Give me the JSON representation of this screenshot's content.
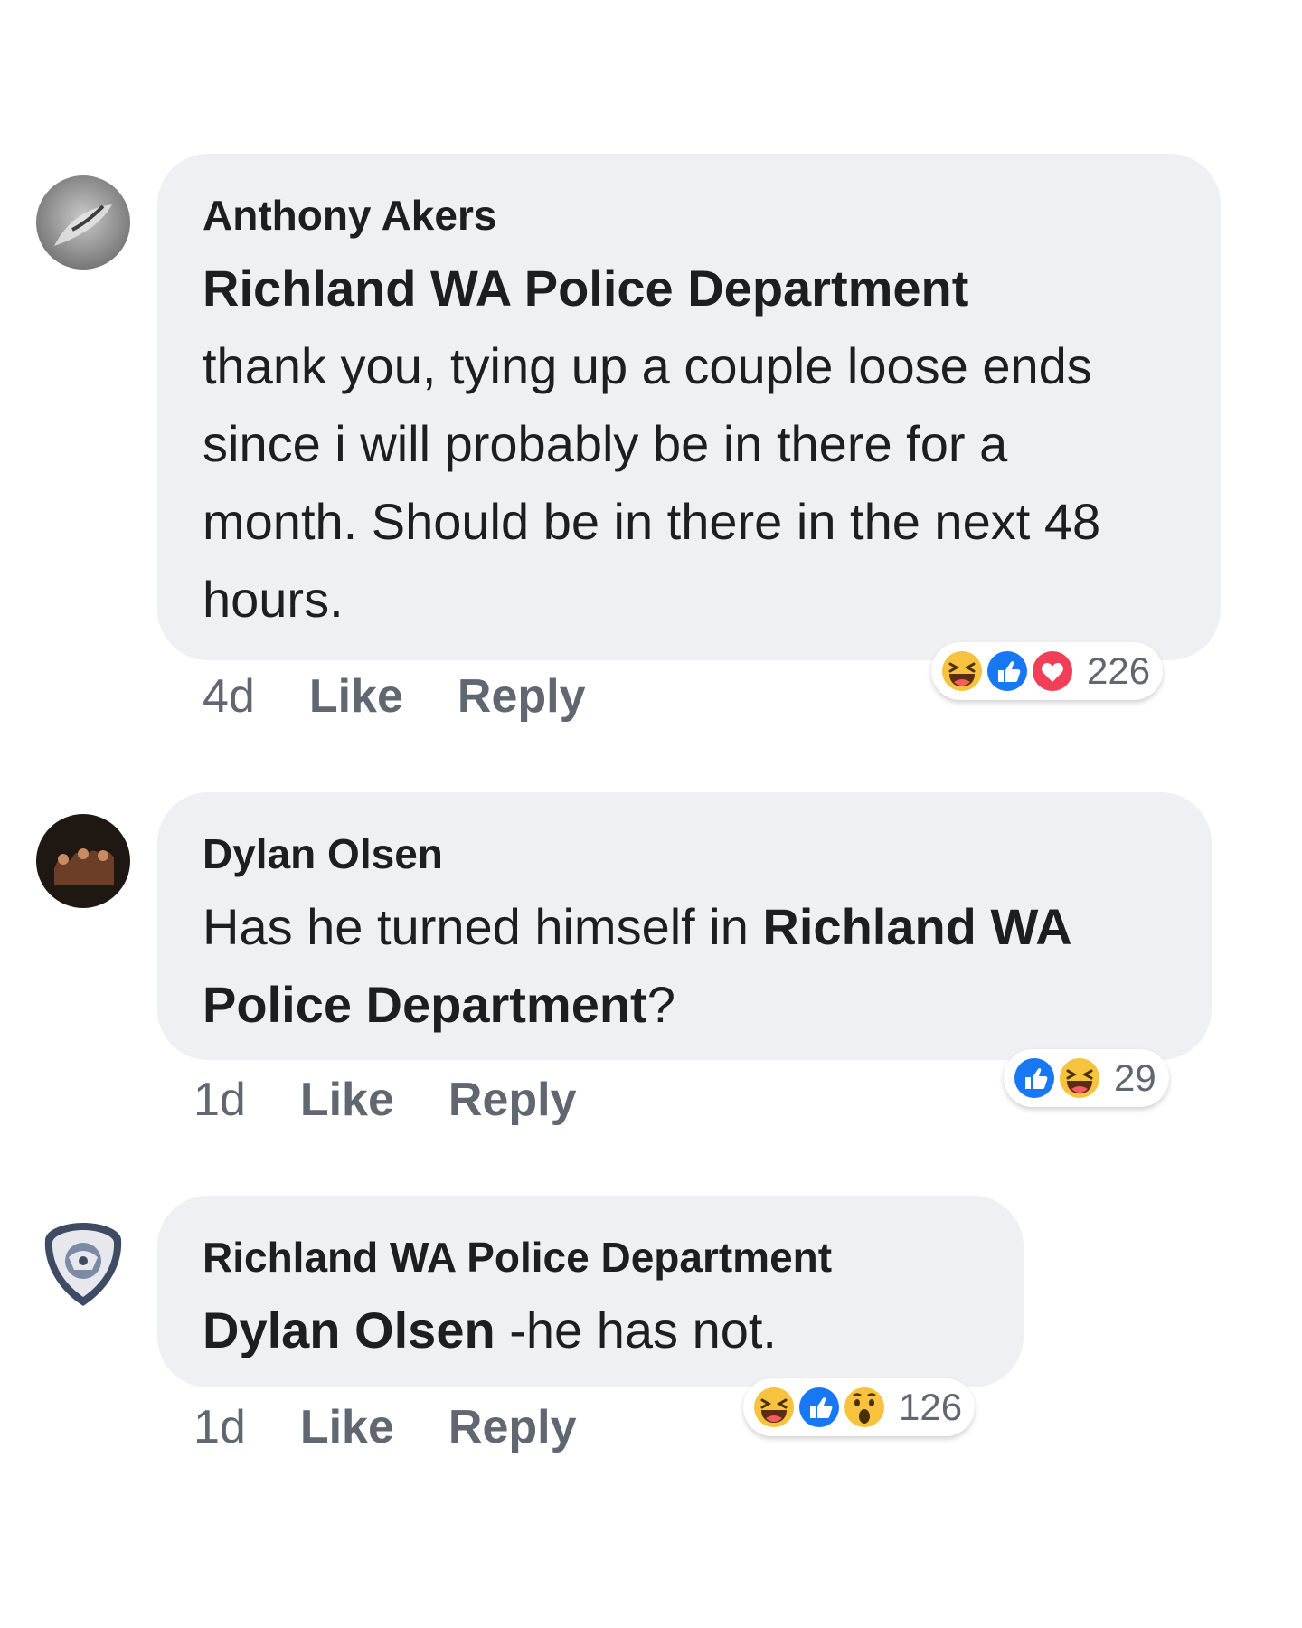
{
  "comments": [
    {
      "author": "Anthony Akers",
      "mention": "Richland WA Police Department",
      "text": "thank you, tying up a couple loose ends since i will probably be in there for a month. Should be in there in the next 48 hours.",
      "time": "4d",
      "like_label": "Like",
      "reply_label": "Reply",
      "reactions": [
        "haha-icon",
        "like-icon",
        "love-icon"
      ],
      "reaction_count": "226"
    },
    {
      "author": "Dylan Olsen",
      "text_prefix": "Has he turned himself in ",
      "mention": "Richland WA Police Department",
      "text_suffix": "?",
      "time": "1d",
      "like_label": "Like",
      "reply_label": "Reply",
      "reactions": [
        "like-icon",
        "haha-icon"
      ],
      "reaction_count": "29"
    },
    {
      "author": "Richland WA Police Department",
      "mention": "Dylan Olsen",
      "text": " -he has not.",
      "time": "1d",
      "like_label": "Like",
      "reply_label": "Reply",
      "reactions": [
        "haha-icon",
        "like-icon",
        "wow-icon"
      ],
      "reaction_count": "126"
    }
  ],
  "colors": {
    "bubble": "#eef0f3",
    "like_blue": "#1877f2",
    "love_red": "#f33e58",
    "emoji_yellow": "#f7c23d",
    "meta_gray": "#606770"
  }
}
